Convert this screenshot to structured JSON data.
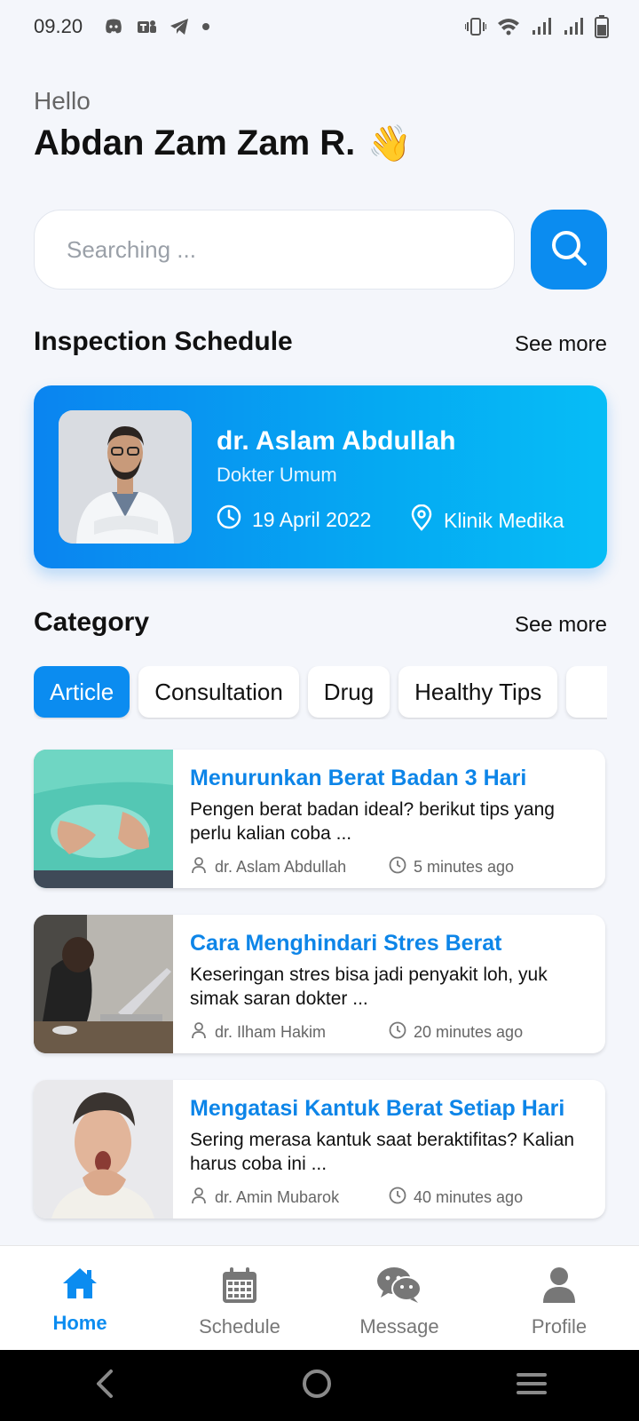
{
  "status_bar": {
    "time": "09.20",
    "left_icons": [
      "discord-icon",
      "teams-icon",
      "telegram-icon",
      "dot-icon"
    ],
    "right_icons": [
      "vibrate-icon",
      "wifi-icon",
      "signal-icon",
      "signal-icon",
      "battery-icon"
    ]
  },
  "greeting": {
    "hello": "Hello",
    "name": "Abdan Zam Zam R.",
    "emoji": "👋"
  },
  "search": {
    "placeholder": "Searching ...",
    "value": ""
  },
  "inspection": {
    "title": "Inspection Schedule",
    "see_more": "See more",
    "card": {
      "doctor_name": "dr. Aslam Abdullah",
      "specialty": "Dokter Umum",
      "date": "19 April 2022",
      "location": "Klinik Medika"
    }
  },
  "category": {
    "title": "Category",
    "see_more": "See more",
    "chips": [
      {
        "label": "Article",
        "active": true
      },
      {
        "label": "Consultation",
        "active": false
      },
      {
        "label": "Drug",
        "active": false
      },
      {
        "label": "Healthy Tips",
        "active": false
      },
      {
        "label": "",
        "active": false
      }
    ]
  },
  "articles": [
    {
      "title": "Menurunkan Berat Badan 3 Hari",
      "description": "Pengen berat badan ideal? berikut tips yang perlu kalian coba ...",
      "author": "dr. Aslam Abdullah",
      "time": "5 minutes ago"
    },
    {
      "title": "Cara Menghindari Stres Berat",
      "description": "Keseringan stres bisa jadi penyakit loh, yuk simak saran dokter ...",
      "author": "dr. Ilham Hakim",
      "time": "20 minutes ago"
    },
    {
      "title": "Mengatasi Kantuk Berat Setiap Hari",
      "description": "Sering merasa kantuk saat beraktifitas? Kalian harus coba ini ...",
      "author": "dr. Amin Mubarok",
      "time": "40 minutes ago"
    }
  ],
  "bottom_nav": [
    {
      "label": "Home",
      "icon": "home-icon",
      "active": true
    },
    {
      "label": "Schedule",
      "icon": "calendar-icon",
      "active": false
    },
    {
      "label": "Message",
      "icon": "chat-icon",
      "active": false
    },
    {
      "label": "Profile",
      "icon": "user-icon",
      "active": false
    }
  ],
  "colors": {
    "accent": "#0b8cf0",
    "article_title": "#0d85e8",
    "background": "#f4f6fb"
  }
}
